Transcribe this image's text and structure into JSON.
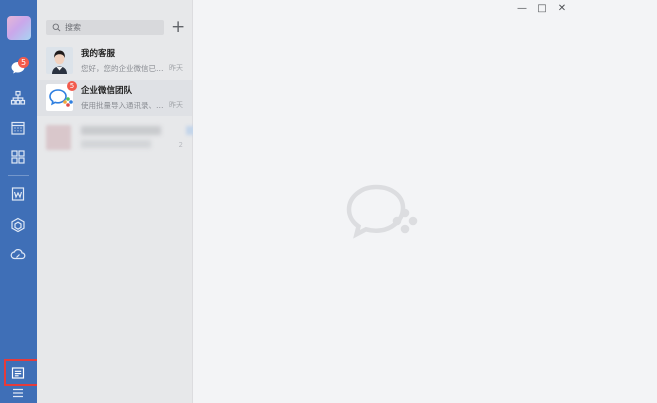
{
  "sidebar": {
    "message_badge": "5",
    "icons": [
      "chat-icon",
      "contacts-org-icon",
      "calendar-icon",
      "workbench-grid-icon",
      "document-icon",
      "cube-app-icon",
      "cloud-drive-icon",
      "notes-icon",
      "menu-icon"
    ]
  },
  "search": {
    "placeholder": "搜索",
    "add_label": "+"
  },
  "conversations": [
    {
      "name": "我的客服",
      "preview": "您好，您的企业微信已…",
      "time": "昨天",
      "badge": ""
    },
    {
      "name": "企业微信团队",
      "preview": "使用批量导入通讯录、…",
      "time": "昨天",
      "badge": "5"
    },
    {
      "name": "",
      "preview": "",
      "time": "2",
      "badge": ""
    }
  ],
  "window_controls": {
    "minimize": "—",
    "maximize": "□",
    "close": "✕"
  },
  "colors": {
    "rail": "#3f6fb7",
    "badge": "#f25b4c",
    "highlight": "#e53b3b"
  }
}
